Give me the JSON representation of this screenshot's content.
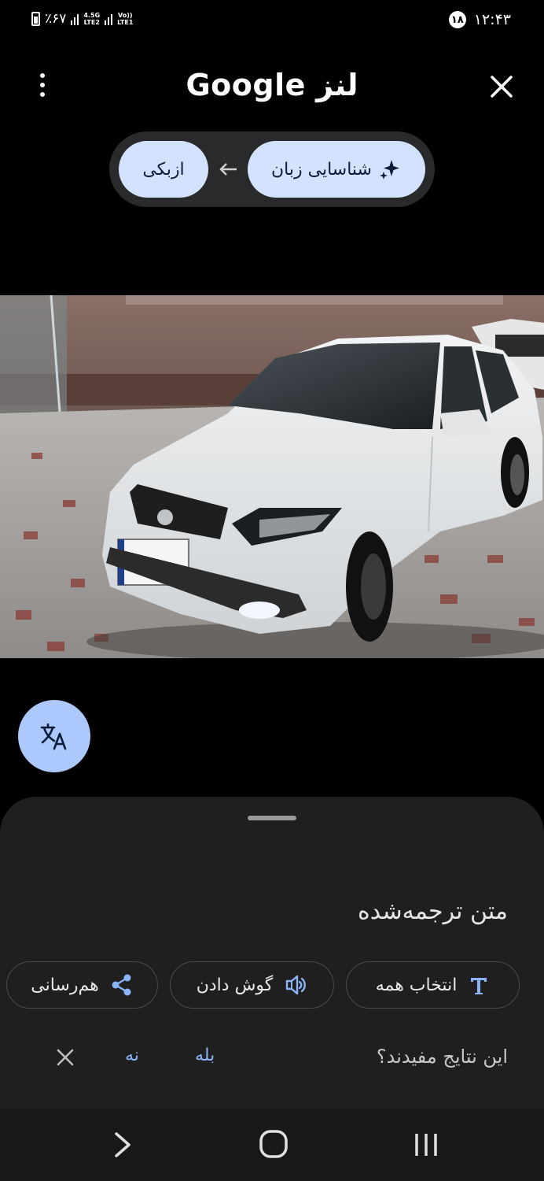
{
  "status_bar": {
    "battery_text": "٪۶۷",
    "network_1": "4.5G\nLTE2",
    "network_2": "Vo))\nLTE1",
    "notification_count": "۱۸",
    "time": "۱۲:۴۳"
  },
  "header": {
    "title": "لنز Google"
  },
  "language_bar": {
    "source_label": "شناسایی زبان",
    "target_label": "ازبکی"
  },
  "bottom_sheet": {
    "title": "متن ترجمه‌شده",
    "actions": {
      "select_all": "انتخاب همه",
      "listen": "گوش دادن",
      "share": "هم‌رسانی"
    },
    "feedback": {
      "question": "این نتایج مفیدند؟",
      "yes": "بله",
      "no": "نه"
    }
  },
  "colors": {
    "chip_bg": "#d3e3fd",
    "fab_bg": "#adc8fb",
    "accent_blue": "#8ab4f8",
    "sheet_bg": "#1f1f1f"
  },
  "icons": {
    "sparkle": "sparkle-icon",
    "arrow": "arrow-left-icon",
    "translate": "translate-icon",
    "text": "text-format-icon",
    "listen": "listen-icon",
    "share": "share-icon",
    "close": "close-icon",
    "menu": "more-vert-icon"
  }
}
